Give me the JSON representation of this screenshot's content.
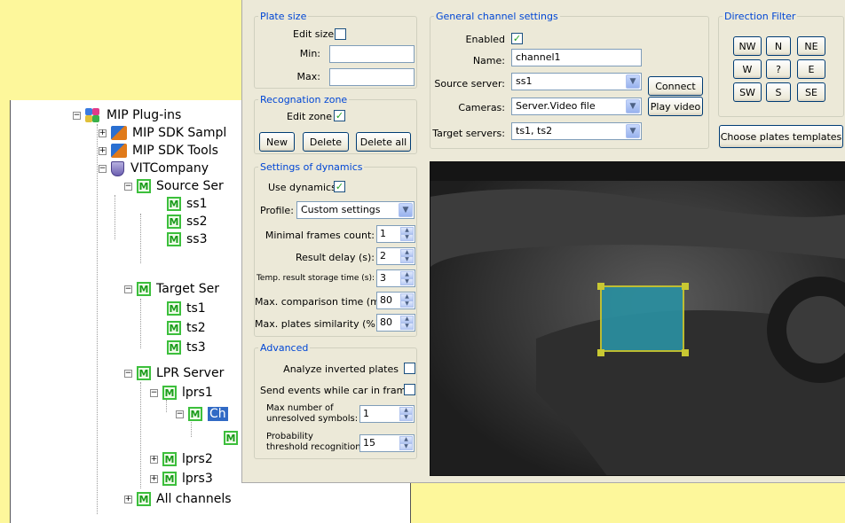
{
  "tree": {
    "root": "MIP Plug-ins",
    "sdk_samples": "MIP SDK Sampl",
    "sdk_tools": "MIP SDK Tools",
    "company": "VITCompany",
    "source_servers": "Source Ser",
    "ss": [
      "ss1",
      "ss2",
      "ss3"
    ],
    "target_servers": "Target Ser",
    "ts": [
      "ts1",
      "ts2",
      "ts3"
    ],
    "lpr_servers": "LPR Server",
    "lprs1": "lprs1",
    "selected_channel": "Ch",
    "lprs2": "lprs2",
    "lprs3": "lprs3",
    "all_channels": "All channels"
  },
  "plate_size": {
    "legend": "Plate size",
    "edit_size_label": "Edit size",
    "min_label": "Min:",
    "max_label": "Max:",
    "min_value": "",
    "max_value": ""
  },
  "recognition_zone": {
    "legend": "Recognation zone",
    "edit_zone_label": "Edit zone",
    "new_label": "New",
    "delete_label": "Delete",
    "delete_all_label": "Delete all"
  },
  "general": {
    "legend": "General channel settings",
    "enabled_label": "Enabled",
    "name_label": "Name:",
    "name_value": "channel1",
    "source_server_label": "Source server:",
    "source_server_value": "ss1",
    "connect_label": "Connect",
    "cameras_label": "Cameras:",
    "cameras_value": "Server.Video file",
    "play_video_label": "Play video",
    "target_servers_label": "Target servers:",
    "target_servers_value": "ts1, ts2"
  },
  "direction_filter": {
    "legend": "Direction Filter",
    "buttons": [
      "NW",
      "N",
      "NE",
      "W",
      "?",
      "E",
      "SW",
      "S",
      "SE"
    ]
  },
  "choose_templates_label": "Choose plates templates",
  "dynamics": {
    "legend": "Settings of dynamics",
    "use_dynamics_label": "Use dynamics",
    "profile_label": "Profile:",
    "profile_value": "Custom settings",
    "min_frames_label": "Minimal frames count:",
    "min_frames_value": "1",
    "result_delay_label": "Result delay (s):",
    "result_delay_value": "2",
    "temp_storage_label": "Temp. result storage time (s):",
    "temp_storage_value": "3",
    "max_comparison_label": "Max. comparison time (ms):",
    "max_comparison_value": "80",
    "max_similarity_label": "Max. plates similarity (%):",
    "max_similarity_value": "80"
  },
  "advanced": {
    "legend": "Advanced",
    "analyze_inverted_label": "Analyze inverted plates",
    "send_events_label": "Send events while car in frame",
    "max_unresolved_label_1": "Max number of",
    "max_unresolved_label_2": "unresolved symbols:",
    "max_unresolved_value": "1",
    "prob_threshold_label_1": "Probability",
    "prob_threshold_label_2": "threshold recognition:",
    "prob_threshold_value": "15"
  },
  "colors": {
    "background": "#fdf79b",
    "legend": "#0046d5",
    "zone_fill": "#2a8fa0",
    "zone_border": "#c8c832"
  }
}
